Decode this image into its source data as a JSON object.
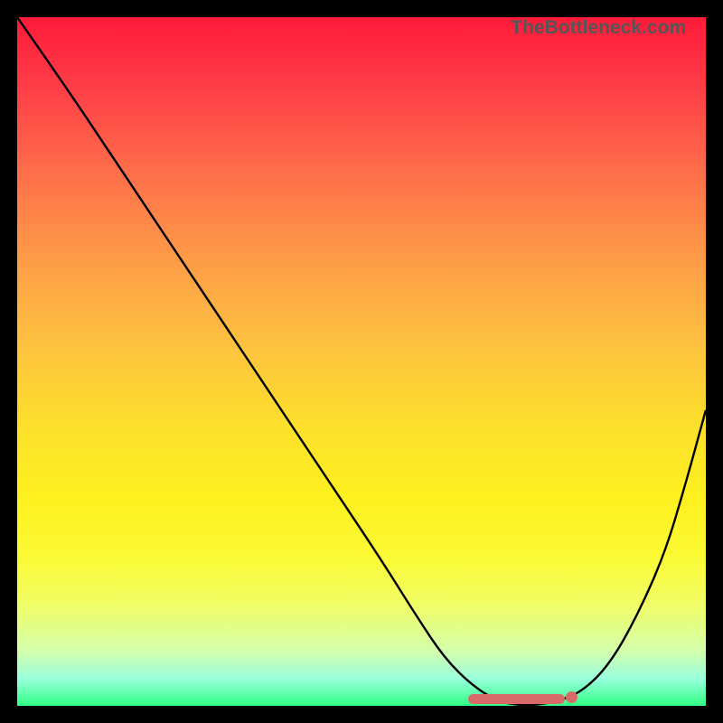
{
  "watermark": "TheBottleneck.com",
  "colors": {
    "curve_stroke": "#000000",
    "marker_fill": "#d86a6a"
  },
  "chart_data": {
    "type": "line",
    "title": "TheBottleneck.com",
    "xlabel": "",
    "ylabel": "",
    "xlim": [
      0,
      1
    ],
    "ylim": [
      0,
      1
    ],
    "series": [
      {
        "name": "bottleneck-curve",
        "x": [
          0.0,
          0.07,
          0.15,
          0.25,
          0.35,
          0.45,
          0.53,
          0.58,
          0.62,
          0.66,
          0.7,
          0.74,
          0.78,
          0.82,
          0.86,
          0.9,
          0.94,
          0.97,
          1.0
        ],
        "y": [
          1.0,
          0.9,
          0.78,
          0.63,
          0.48,
          0.33,
          0.21,
          0.13,
          0.07,
          0.03,
          0.005,
          0.0,
          0.005,
          0.02,
          0.06,
          0.13,
          0.22,
          0.32,
          0.43
        ]
      }
    ],
    "markers": {
      "band": {
        "x_start": 0.655,
        "x_end": 0.795,
        "y": 0.006
      },
      "dot": {
        "x": 0.805,
        "y": 0.013
      }
    },
    "gradient_stops": [
      {
        "pos": 0.0,
        "color": "#fe1a3a"
      },
      {
        "pos": 0.5,
        "color": "#fdd030"
      },
      {
        "pos": 1.0,
        "color": "#2fff84"
      }
    ]
  }
}
